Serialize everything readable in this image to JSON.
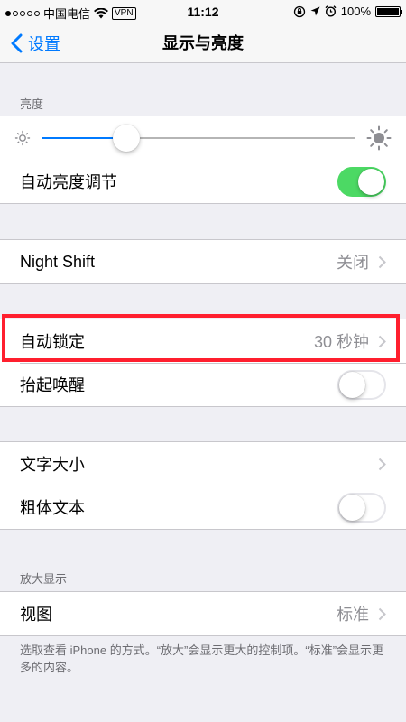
{
  "status_bar": {
    "carrier": "中国电信",
    "vpn": "VPN",
    "time": "11:12",
    "battery": "100%",
    "battery_level": 1.0
  },
  "nav": {
    "back_label": "设置",
    "title": "显示与亮度"
  },
  "brightness": {
    "header": "亮度",
    "level": 0.27,
    "auto_label": "自动亮度调节",
    "auto_on": true
  },
  "night_shift": {
    "label": "Night Shift",
    "value": "关闭"
  },
  "lock": {
    "auto_lock_label": "自动锁定",
    "auto_lock_value": "30 秒钟",
    "raise_to_wake_label": "抬起唤醒",
    "raise_to_wake_on": false
  },
  "text": {
    "text_size_label": "文字大小",
    "bold_text_label": "粗体文本",
    "bold_text_on": false
  },
  "zoom": {
    "header": "放大显示",
    "view_label": "视图",
    "view_value": "标准",
    "note": "选取查看 iPhone 的方式。“放大”会显示更大的控制项。“标准”会显示更多的内容。"
  },
  "colors": {
    "accent": "#007aff",
    "toggle_on": "#4cd964",
    "highlight": "#ff1f2e"
  }
}
